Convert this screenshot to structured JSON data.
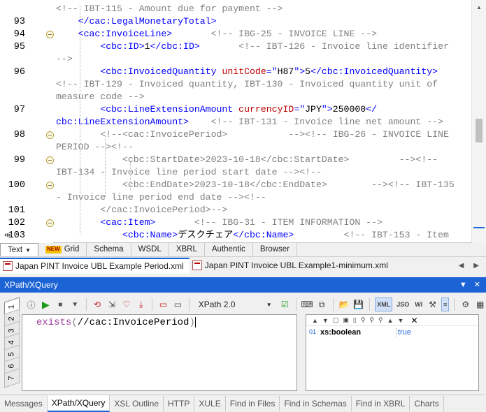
{
  "editor": {
    "lines": [
      {
        "num": "",
        "segs": [
          [
            "cm",
            "<!-- IBT-115 - Amount due for payment -->"
          ]
        ]
      },
      {
        "num": "93",
        "segs": [
          [
            "tx",
            "    "
          ],
          [
            "tg",
            "</cac:LegalMonetaryTotal>"
          ]
        ]
      },
      {
        "num": "94",
        "segs": [
          [
            "tx",
            "    "
          ],
          [
            "tg",
            "<cac:InvoiceLine>"
          ],
          [
            "tx",
            "       "
          ],
          [
            "cm",
            "<!-- IBG-25 - INVOICE LINE -->"
          ]
        ]
      },
      {
        "num": "95",
        "segs": [
          [
            "tx",
            "        "
          ],
          [
            "tg",
            "<cbc:ID>"
          ],
          [
            "tx",
            "1"
          ],
          [
            "tg",
            "</cbc:ID>"
          ],
          [
            "tx",
            "       "
          ],
          [
            "cm",
            "<!-- IBT-126 - Invoice line identifier"
          ]
        ]
      },
      {
        "num": "",
        "segs": [
          [
            "cm",
            "-->"
          ]
        ]
      },
      {
        "num": "96",
        "segs": [
          [
            "tx",
            "        "
          ],
          [
            "tg",
            "<cbc:InvoicedQuantity "
          ],
          [
            "at",
            "unitCode"
          ],
          [
            "tg",
            "=\""
          ],
          [
            "av",
            "H87"
          ],
          [
            "tg",
            "\">"
          ],
          [
            "tx",
            "5"
          ],
          [
            "tg",
            "</cbc:InvoicedQuantity>"
          ]
        ]
      },
      {
        "num": "",
        "segs": [
          [
            "cm",
            "<!-- IBT-129 - Invoiced quantity, IBT-130 - Invoiced quantity unit of"
          ]
        ]
      },
      {
        "num": "",
        "segs": [
          [
            "cm",
            "measure code -->"
          ]
        ]
      },
      {
        "num": "97",
        "segs": [
          [
            "tx",
            "        "
          ],
          [
            "tg",
            "<cbc:LineExtensionAmount "
          ],
          [
            "at",
            "currencyID"
          ],
          [
            "tg",
            "=\""
          ],
          [
            "av",
            "JPY"
          ],
          [
            "tg",
            "\">"
          ],
          [
            "tx",
            "250000"
          ],
          [
            "tg",
            "</"
          ]
        ]
      },
      {
        "num": "",
        "segs": [
          [
            "tg",
            "cbc:LineExtensionAmount>"
          ],
          [
            "tx",
            "    "
          ],
          [
            "cm",
            "<!-- IBT-131 - Invoice line net amount -->"
          ]
        ]
      },
      {
        "num": "98",
        "segs": [
          [
            "tx",
            "        "
          ],
          [
            "cm",
            "<!--<cac:InvoicePeriod>           --><!-- IBG-26 - INVOICE LINE"
          ]
        ]
      },
      {
        "num": "",
        "segs": [
          [
            "cm",
            "PERIOD --><!--"
          ]
        ]
      },
      {
        "num": "99",
        "segs": [
          [
            "tx",
            "            "
          ],
          [
            "cm",
            "<cbc:StartDate>2023-10-18</cbc:StartDate>         --><!--"
          ]
        ]
      },
      {
        "num": "",
        "segs": [
          [
            "cm",
            "IBT-134 - Invoice line period start date --><!--"
          ]
        ]
      },
      {
        "num": "100",
        "segs": [
          [
            "tx",
            "            "
          ],
          [
            "cm",
            "<cbc:EndDate>2023-10-18</cbc:EndDate>        --><!-- IBT-135"
          ]
        ]
      },
      {
        "num": "",
        "segs": [
          [
            "cm",
            "- Invoice line period end date --><!--"
          ]
        ]
      },
      {
        "num": "101",
        "segs": [
          [
            "tx",
            "        "
          ],
          [
            "cm",
            "</cac:InvoicePeriod>-->"
          ]
        ]
      },
      {
        "num": "102",
        "segs": [
          [
            "tx",
            "        "
          ],
          [
            "tg",
            "<cac:Item>"
          ],
          [
            "tx",
            "       "
          ],
          [
            "cm",
            "<!-- IBG-31 - ITEM INFORMATION -->"
          ]
        ]
      },
      {
        "num": "103",
        "segs": [
          [
            "tx",
            "            "
          ],
          [
            "tg",
            "<cbc:Name>"
          ],
          [
            "tx",
            "デスクチェア"
          ],
          [
            "tg",
            "</cbc:Name>"
          ],
          [
            "tx",
            "         "
          ],
          [
            "cm",
            "<!-- IBT-153 - Item"
          ]
        ]
      }
    ]
  },
  "view_tabs": [
    {
      "label": "Text",
      "active": true,
      "dropdown": true
    },
    {
      "label": "Grid",
      "badge": "NEW"
    },
    {
      "label": "Schema"
    },
    {
      "label": "WSDL"
    },
    {
      "label": "XBRL"
    },
    {
      "label": "Authentic"
    },
    {
      "label": "Browser"
    }
  ],
  "doc_tabs": [
    {
      "label": "Japan PINT Invoice UBL Example Period.xml",
      "active": true
    },
    {
      "label": "Japan PINT Invoice UBL Example1-minimum.xml",
      "active": false
    }
  ],
  "xpath": {
    "title": "XPath/XQuery",
    "version": "XPath 2.0",
    "expression_fn": "exists",
    "expression_open": "(",
    "expression_arg": "//cac:InvoicePeriod",
    "expression_close": ")",
    "tab_numbers": [
      "1",
      "2",
      "3",
      "4",
      "5",
      "6",
      "7"
    ],
    "toolbar_labels": {
      "xml": "XML",
      "json": "JSO",
      "wi": "WI"
    },
    "result": {
      "index": "01",
      "type": "xs:boolean",
      "value": "true"
    }
  },
  "bottom_tabs": [
    "Messages",
    "XPath/XQuery",
    "XSL Outline",
    "HTTP",
    "XULE",
    "Find in Files",
    "Find in Schemas",
    "Find in XBRL",
    "Charts"
  ],
  "bottom_active": "XPath/XQuery",
  "colors": {
    "accent": "#1c64d6",
    "tag": "#0000ff",
    "comment": "#808080",
    "attr": "#c00000"
  }
}
